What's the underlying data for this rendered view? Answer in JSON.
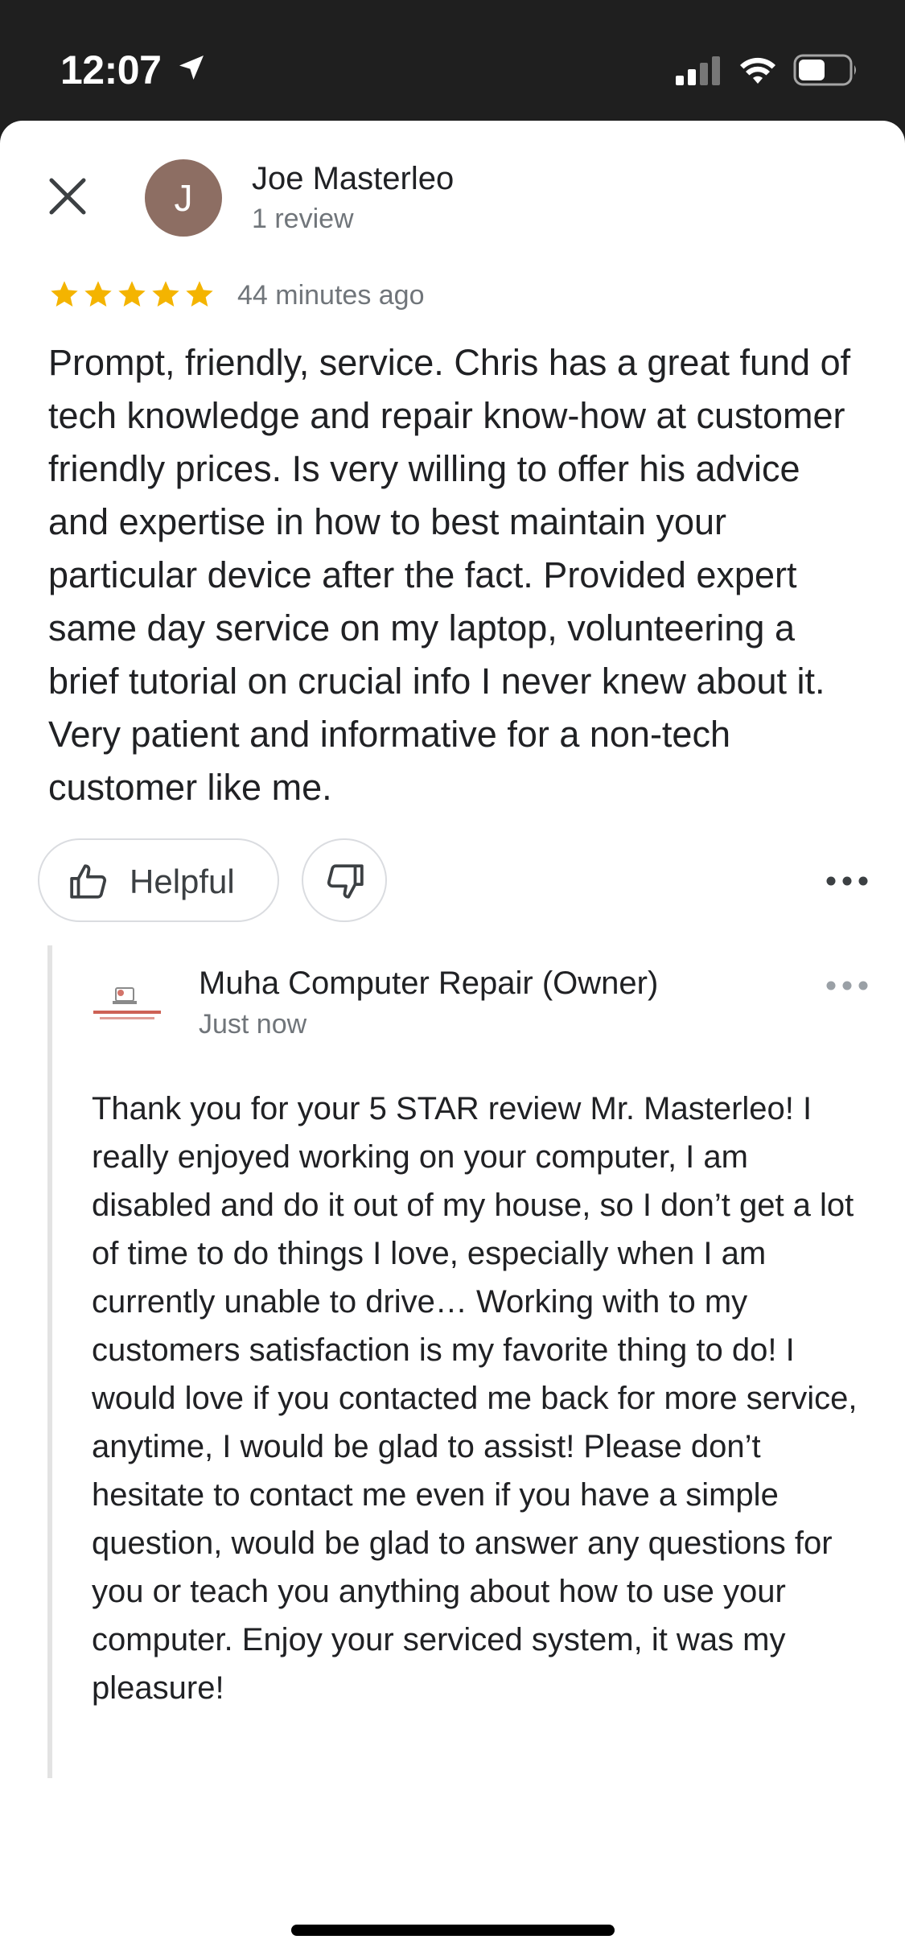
{
  "status_bar": {
    "time": "12:07",
    "icons": [
      "location-arrow-icon",
      "cellular-signal-icon",
      "wifi-icon",
      "battery-icon"
    ]
  },
  "review": {
    "reviewer_name": "Joe Masterleo",
    "avatar_initial": "J",
    "review_count": "1 review",
    "rating": 5,
    "time": "44 minutes ago",
    "text": "Prompt, friendly, service. Chris has a great fund of tech knowledge and repair know-how at customer friendly prices. Is very willing to offer his advice and expertise in how to best maintain your particular device after the fact. Provided expert same day service on my laptop, volunteering a brief tutorial on crucial info I never knew about it. Very patient and informative for a non-tech customer like me."
  },
  "actions": {
    "helpful_label": "Helpful"
  },
  "owner_reply": {
    "name": "Muha Computer Repair (Owner)",
    "time": "Just now",
    "text": "Thank you for your 5 STAR review Mr. Masterleo! I really enjoyed working on your computer, I am disabled and do it out of my house, so I don’t get a lot of time to do things I love, especially when I am currently unable to drive… Working with to my customers satisfaction is my favorite thing to do! I would love if you contacted me back for more service, anytime, I would be glad to assist! Please don’t hesitate to contact me even if you have a simple question, would be glad to answer any questions for you or teach you anything about how to use your computer. Enjoy your serviced system, it was my pleasure!"
  },
  "colors": {
    "star": "#f4b400",
    "avatar_bg": "#8d6e63",
    "secondary_text": "#70757a",
    "primary_text": "#202124"
  }
}
